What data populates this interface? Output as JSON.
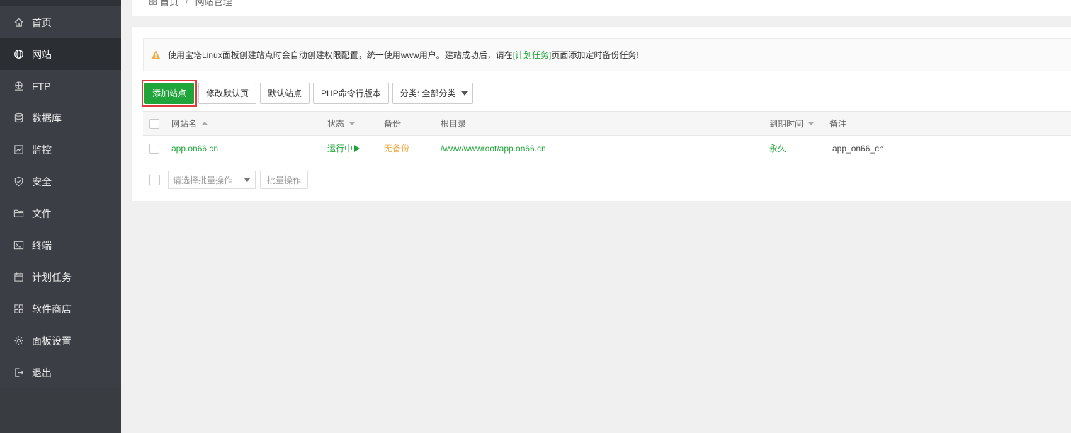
{
  "sidebar": {
    "items": [
      {
        "label": "首页",
        "icon": "home-icon"
      },
      {
        "label": "网站",
        "icon": "globe-icon",
        "active": true
      },
      {
        "label": "FTP",
        "icon": "ftp-icon"
      },
      {
        "label": "数据库",
        "icon": "database-icon"
      },
      {
        "label": "监控",
        "icon": "monitor-icon"
      },
      {
        "label": "安全",
        "icon": "shield-icon"
      },
      {
        "label": "文件",
        "icon": "folder-icon"
      },
      {
        "label": "终端",
        "icon": "terminal-icon"
      },
      {
        "label": "计划任务",
        "icon": "calendar-icon"
      },
      {
        "label": "软件商店",
        "icon": "apps-icon"
      },
      {
        "label": "面板设置",
        "icon": "gear-icon"
      },
      {
        "label": "退出",
        "icon": "logout-icon"
      }
    ]
  },
  "breadcrumb": {
    "home": "首页",
    "sep": "/",
    "current": "网站管理"
  },
  "alert": {
    "text_before": "使用宝塔Linux面板创建站点时会自动创建权限配置，统一使用www用户。建站成功后，请在",
    "link": "[计划任务]",
    "text_after": "页面添加定时备份任务!"
  },
  "toolbar": {
    "add_site": "添加站点",
    "edit_default_page": "修改默认页",
    "default_site": "默认站点",
    "php_cli_version": "PHP命令行版本",
    "category": "分类: 全部分类"
  },
  "table": {
    "headers": {
      "name": "网站名",
      "status": "状态",
      "backup": "备份",
      "root": "根目录",
      "expire": "到期时间",
      "note": "备注"
    },
    "rows": [
      {
        "name": "app.on66.cn",
        "status": "运行中",
        "backup": "无备份",
        "root": "/www/wwwroot/app.on66.cn",
        "expire": "永久",
        "note": "app_on66_cn"
      }
    ]
  },
  "batch": {
    "placeholder": "请选择批量操作",
    "button": "批量操作"
  },
  "colors": {
    "accent": "#20a53a",
    "warning": "#f0ad4e",
    "sidebar_bg": "#3b3f45",
    "highlight_border": "#e03b3b"
  }
}
